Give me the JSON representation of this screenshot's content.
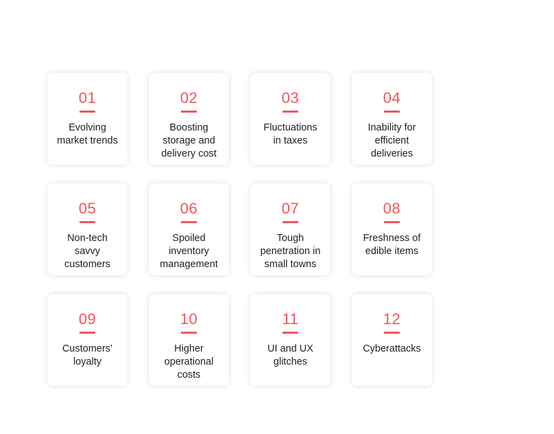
{
  "accent_color": "#f0545c",
  "cards": [
    {
      "number": "01",
      "label": "Evolving\nmarket trends"
    },
    {
      "number": "02",
      "label": "Boosting\nstorage and\ndelivery cost"
    },
    {
      "number": "03",
      "label": "Fluctuations\nin taxes"
    },
    {
      "number": "04",
      "label": "Inability for\nefficient\ndeliveries"
    },
    {
      "number": "05",
      "label": "Non-tech\nsavvy\ncustomers"
    },
    {
      "number": "06",
      "label": "Spoiled\ninventory\nmanagement"
    },
    {
      "number": "07",
      "label": "Tough\npenetration in\nsmall towns"
    },
    {
      "number": "08",
      "label": "Freshness of\nedible items"
    },
    {
      "number": "09",
      "label": "Customers’\nloyalty"
    },
    {
      "number": "10",
      "label": "Higher\noperational\ncosts"
    },
    {
      "number": "11",
      "label": "UI and UX\nglitches"
    },
    {
      "number": "12",
      "label": "Cyberattacks"
    }
  ]
}
